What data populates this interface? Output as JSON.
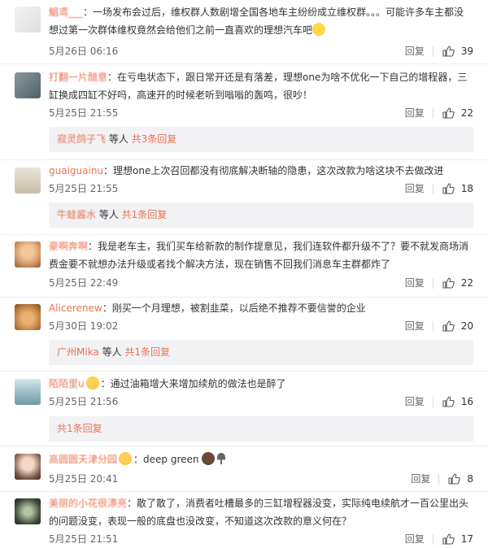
{
  "comments": [
    {
      "user": "鲳鸢___",
      "text": "：一场发布会过后，维权群人数剧增全国各地车主纷纷成立维权群。。。可能许多车主都没想过第一次群体维权竟然会给他们之前一直喜欢的理想汽车吧",
      "time": "5月26日 06:16",
      "reply": "回复",
      "likes": "39"
    },
    {
      "user": "打翻一片醋意",
      "text": "：在亏电状态下，跟日常开还是有落差，理想one为啥不优化一下自己的增程器，三缸换成四缸不好吗，高速开的时候老听到嗡嗡的轰鸣，很吵！",
      "time": "5月25日 21:55",
      "reply": "回复",
      "likes": "22",
      "sub": {
        "user": "寂灵鸽子飞",
        "mid": " 等人 ",
        "total": "共3条回复"
      }
    },
    {
      "user": "guaiguainu",
      "text": "：理想one上次召回都没有彻底解决断轴的隐患，这次改款为啥这块不去做改进",
      "time": "5月25日 21:55",
      "reply": "回复",
      "likes": "18",
      "sub": {
        "user": "牛蛙酱水",
        "mid": " 等人 ",
        "total": "共1条回复"
      }
    },
    {
      "user": "豪啊奔啊",
      "text": "：我是老车主，我们买车给新款的制作提意见，我们连软件都升级不了？要不就发商场消费金要不就想办法升级或者找个解决方法，现在销售不回我们消息车主群都炸了",
      "time": "5月25日 22:49",
      "reply": "回复",
      "likes": "22"
    },
    {
      "user": "Alicerenew",
      "text": "：刚买一个月理想，被割韭菜，以后绝不推荐不要信誉的企业",
      "time": "5月30日 19:02",
      "reply": "回复",
      "likes": "20",
      "sub": {
        "user": "广州Mika",
        "mid": " 等人 ",
        "total": "共1条回复"
      }
    },
    {
      "user": "陌陌里u",
      "text": "：通过油箱增大来增加续航的做法也是醉了",
      "time": "5月25日 21:56",
      "reply": "回复",
      "likes": "16",
      "sub": {
        "user": "",
        "mid": "",
        "total": "共1条回复"
      }
    },
    {
      "user": "高圆圆天津分园",
      "text": "：deep green",
      "time": "5月25日 20:41",
      "reply": "回复",
      "likes": "8"
    },
    {
      "user": "美丽的小花很漂亮",
      "text": "：散了散了，消费者吐槽最多的三缸增程器没变，实际纯电续航才一百公里出头的问题没变，表现一般的底盘也没改变，不知道这次改款的意义何在？",
      "time": "5月25日 21:51",
      "reply": "回复",
      "likes": "17"
    }
  ],
  "colors": {
    "accent": "#eb7350",
    "subbg": "#f2f2f5"
  },
  "icons": {
    "like": "thumbs-up-icon",
    "emoji": "smile-emoji-icon"
  }
}
